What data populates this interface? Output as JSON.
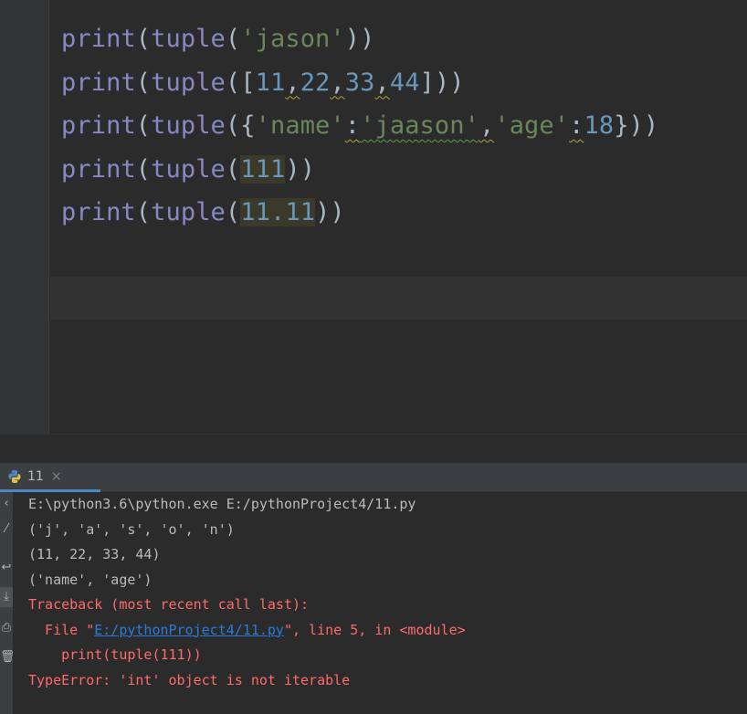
{
  "editor": {
    "lines": [
      {
        "parts": [
          {
            "t": "print",
            "c": "fn"
          },
          {
            "t": "(",
            "c": "punc"
          },
          {
            "t": "tuple",
            "c": "fn"
          },
          {
            "t": "(",
            "c": "punc"
          },
          {
            "t": "'jason'",
            "c": "str"
          },
          {
            "t": "))",
            "c": "punc"
          }
        ]
      },
      {
        "parts": [
          {
            "t": "print",
            "c": "fn"
          },
          {
            "t": "(",
            "c": "punc"
          },
          {
            "t": "tuple",
            "c": "fn"
          },
          {
            "t": "([",
            "c": "punc"
          },
          {
            "t": "11",
            "c": "num"
          },
          {
            "t": ",",
            "c": "punc squig"
          },
          {
            "t": "22",
            "c": "num"
          },
          {
            "t": ",",
            "c": "punc squig"
          },
          {
            "t": "33",
            "c": "num"
          },
          {
            "t": ",",
            "c": "punc squig"
          },
          {
            "t": "44",
            "c": "num"
          },
          {
            "t": "]))",
            "c": "punc"
          }
        ]
      },
      {
        "parts": [
          {
            "t": "print",
            "c": "fn"
          },
          {
            "t": "(",
            "c": "punc"
          },
          {
            "t": "tuple",
            "c": "fn"
          },
          {
            "t": "({",
            "c": "punc"
          },
          {
            "t": "'name'",
            "c": "str"
          },
          {
            "t": ":",
            "c": "punc squig"
          },
          {
            "t": "'jaason'",
            "c": "str squig-g"
          },
          {
            "t": ",",
            "c": "punc squig"
          },
          {
            "t": "'age'",
            "c": "str"
          },
          {
            "t": ":",
            "c": "punc squig"
          },
          {
            "t": "18",
            "c": "num"
          },
          {
            "t": "}))",
            "c": "punc"
          }
        ]
      },
      {
        "parts": [
          {
            "t": "print",
            "c": "fn"
          },
          {
            "t": "(",
            "c": "punc"
          },
          {
            "t": "tuple",
            "c": "fn"
          },
          {
            "t": "(",
            "c": "punc"
          },
          {
            "t": "111",
            "c": "num warn-hl"
          },
          {
            "t": "))",
            "c": "punc"
          }
        ]
      },
      {
        "parts": [
          {
            "t": "print",
            "c": "fn"
          },
          {
            "t": "(",
            "c": "punc"
          },
          {
            "t": "tuple",
            "c": "fn"
          },
          {
            "t": "(",
            "c": "punc"
          },
          {
            "t": "11.11",
            "c": "num warn-hl"
          },
          {
            "t": "))",
            "c": "punc"
          }
        ]
      }
    ]
  },
  "run_panel": {
    "tab_label": "11",
    "tab_close": "×",
    "tab_icon": "python-icon",
    "toolbar_icons": [
      "scroll-up-icon",
      "wrap-icon",
      "scroll-down-icon",
      "scroll-to-end-icon",
      "pin-icon",
      "delete-icon"
    ]
  },
  "console": {
    "lines": [
      {
        "parts": [
          {
            "t": "E:\\python3.6\\python.exe E:/pythonProject4/11.py",
            "c": ""
          }
        ]
      },
      {
        "parts": [
          {
            "t": "('j', 'a', 's', 'o', 'n')",
            "c": ""
          }
        ]
      },
      {
        "parts": [
          {
            "t": "(11, 22, 33, 44)",
            "c": ""
          }
        ]
      },
      {
        "parts": [
          {
            "t": "('name', 'age')",
            "c": ""
          }
        ]
      },
      {
        "parts": [
          {
            "t": "Traceback (most recent call last):",
            "c": "con-err"
          }
        ]
      },
      {
        "parts": [
          {
            "t": "  File \"",
            "c": "con-err"
          },
          {
            "t": "E:/pythonProject4/11.py",
            "c": "con-link"
          },
          {
            "t": "\", line 5, in <module>",
            "c": "con-err"
          }
        ]
      },
      {
        "parts": [
          {
            "t": "    print(tuple(111))",
            "c": "con-err"
          }
        ]
      },
      {
        "parts": [
          {
            "t": "TypeError: 'int' object is not iterable",
            "c": "con-err"
          }
        ]
      }
    ]
  },
  "colors": {
    "editor_bg": "#2b2b2b",
    "keyword_builtin": "#8888c6",
    "string": "#6a8759",
    "number": "#6897bb",
    "error_text": "#ff6b68",
    "link": "#287bde",
    "tab_underline": "#4a88c7"
  }
}
